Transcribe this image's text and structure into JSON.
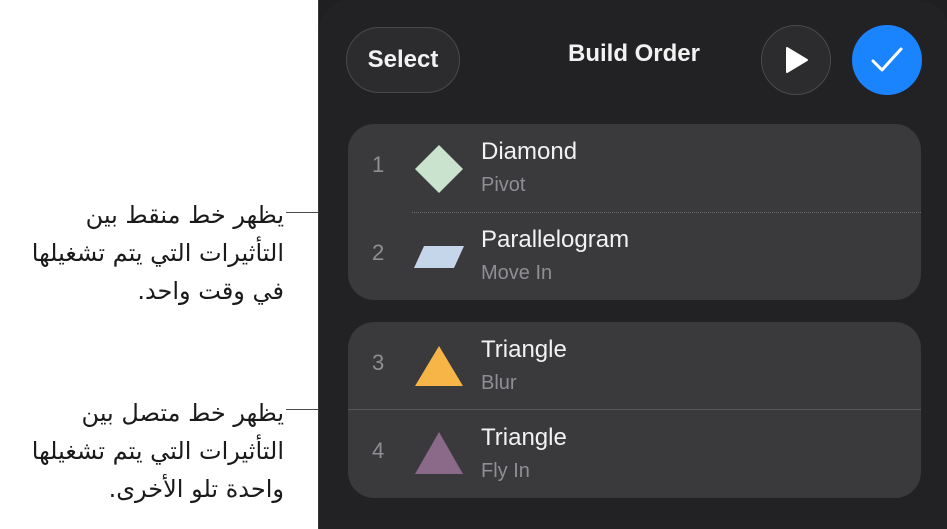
{
  "callouts": [
    {
      "lines": [
        "يظهر خط منقط بين",
        "التأثيرات التي يتم تشغيلها",
        "في وقت واحد."
      ]
    },
    {
      "lines": [
        "يظهر خط متصل بين",
        "التأثيرات التي يتم تشغيلها",
        "واحدة تلو الأخرى."
      ]
    }
  ],
  "header": {
    "select_label": "Select",
    "title": "Build Order",
    "play_icon": "play-icon",
    "done_icon": "checkmark-icon",
    "accent_color": "#1a84ff"
  },
  "groups": [
    {
      "separator": "dotted",
      "items": [
        {
          "number": "1",
          "name": "Diamond",
          "effect": "Pivot",
          "icon": "diamond-icon",
          "color": "#c9e3cf"
        },
        {
          "number": "2",
          "name": "Parallelogram",
          "effect": "Move In",
          "icon": "parallelogram-icon",
          "color": "#c5d6ea"
        }
      ]
    },
    {
      "separator": "solid",
      "items": [
        {
          "number": "3",
          "name": "Triangle",
          "effect": "Blur",
          "icon": "triangle-icon",
          "color": "#f7b548"
        },
        {
          "number": "4",
          "name": "Triangle",
          "effect": "Fly In",
          "icon": "triangle-icon",
          "color": "#8a6a88"
        }
      ]
    }
  ]
}
